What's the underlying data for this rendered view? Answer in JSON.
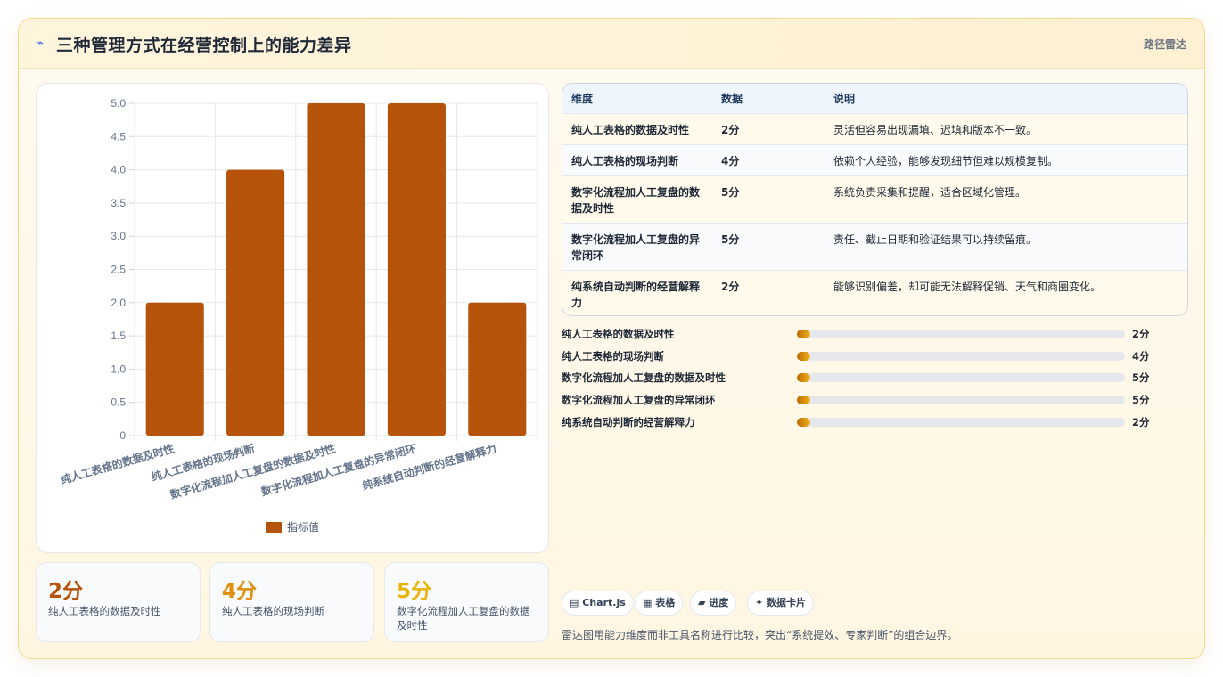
{
  "header": {
    "icon": "lightning-icon",
    "title": "三种管理方式在经营控制上的能力差异",
    "tag": "路径雷达"
  },
  "colors": {
    "bar": "#b5530a",
    "accent_dark": "#b5530a",
    "accent_mid": "#e0900f",
    "accent_light": "#eab308"
  },
  "chart_data": {
    "type": "bar",
    "categories": [
      "纯人工表格的数据及时性",
      "纯人工表格的现场判断",
      "数字化流程加人工复盘的数据及时性",
      "数字化流程加人工复盘的异常闭环",
      "纯系统自动判断的经营解释力"
    ],
    "series": [
      {
        "name": "指标值",
        "values": [
          2,
          4,
          5,
          5,
          2
        ]
      }
    ],
    "y_ticks": [
      "0",
      "0.5",
      "1.0",
      "1.5",
      "2.0",
      "2.5",
      "3.0",
      "3.5",
      "4.0",
      "4.5",
      "5.0"
    ],
    "ylim": [
      0,
      5
    ],
    "grid": true,
    "legend_position": "bottom"
  },
  "stats": [
    {
      "value": "2分",
      "label": "纯人工表格的数据及时性"
    },
    {
      "value": "4分",
      "label": "纯人工表格的现场判断"
    },
    {
      "value": "5分",
      "label": "数字化流程加人工复盘的数据及时性"
    }
  ],
  "table": {
    "headers": [
      "维度",
      "数据",
      "说明"
    ],
    "rows": [
      {
        "dim": "纯人工表格的数据及时性",
        "score": "2分",
        "desc": "灵活但容易出现漏填、迟填和版本不一致。"
      },
      {
        "dim": "纯人工表格的现场判断",
        "score": "4分",
        "desc": "依赖个人经验，能够发现细节但难以规模复制。"
      },
      {
        "dim": "数字化流程加人工复盘的数据及时性",
        "score": "5分",
        "desc": "系统负责采集和提醒，适合区域化管理。"
      },
      {
        "dim": "数字化流程加人工复盘的异常闭环",
        "score": "5分",
        "desc": "责任、截止日期和验证结果可以持续留痕。"
      },
      {
        "dim": "纯系统自动判断的经营解释力",
        "score": "2分",
        "desc": "能够识别偏差，却可能无法解释促销、天气和商圈变化。"
      }
    ]
  },
  "progress": [
    {
      "label": "纯人工表格的数据及时性",
      "value": "2分",
      "fraction": 0.04
    },
    {
      "label": "纯人工表格的现场判断",
      "value": "4分",
      "fraction": 0.04
    },
    {
      "label": "数字化流程加人工复盘的数据及时性",
      "value": "5分",
      "fraction": 0.04
    },
    {
      "label": "数字化流程加人工复盘的异常闭环",
      "value": "5分",
      "fraction": 0.04
    },
    {
      "label": "纯系统自动判断的经营解释力",
      "value": "2分",
      "fraction": 0.04
    }
  ],
  "chips": [
    {
      "icon": "chart-icon",
      "glyph": "▤",
      "label": "Chart.js"
    },
    {
      "icon": "table-icon",
      "glyph": "▦",
      "label": "表格"
    },
    {
      "icon": "progress-icon",
      "glyph": "▰",
      "label": "进度"
    },
    {
      "icon": "sparkle-icon",
      "glyph": "✦",
      "label": "数据卡片"
    }
  ],
  "footer_note": "雷达图用能力维度而非工具名称进行比较，突出“系统提效、专家判断”的组合边界。"
}
